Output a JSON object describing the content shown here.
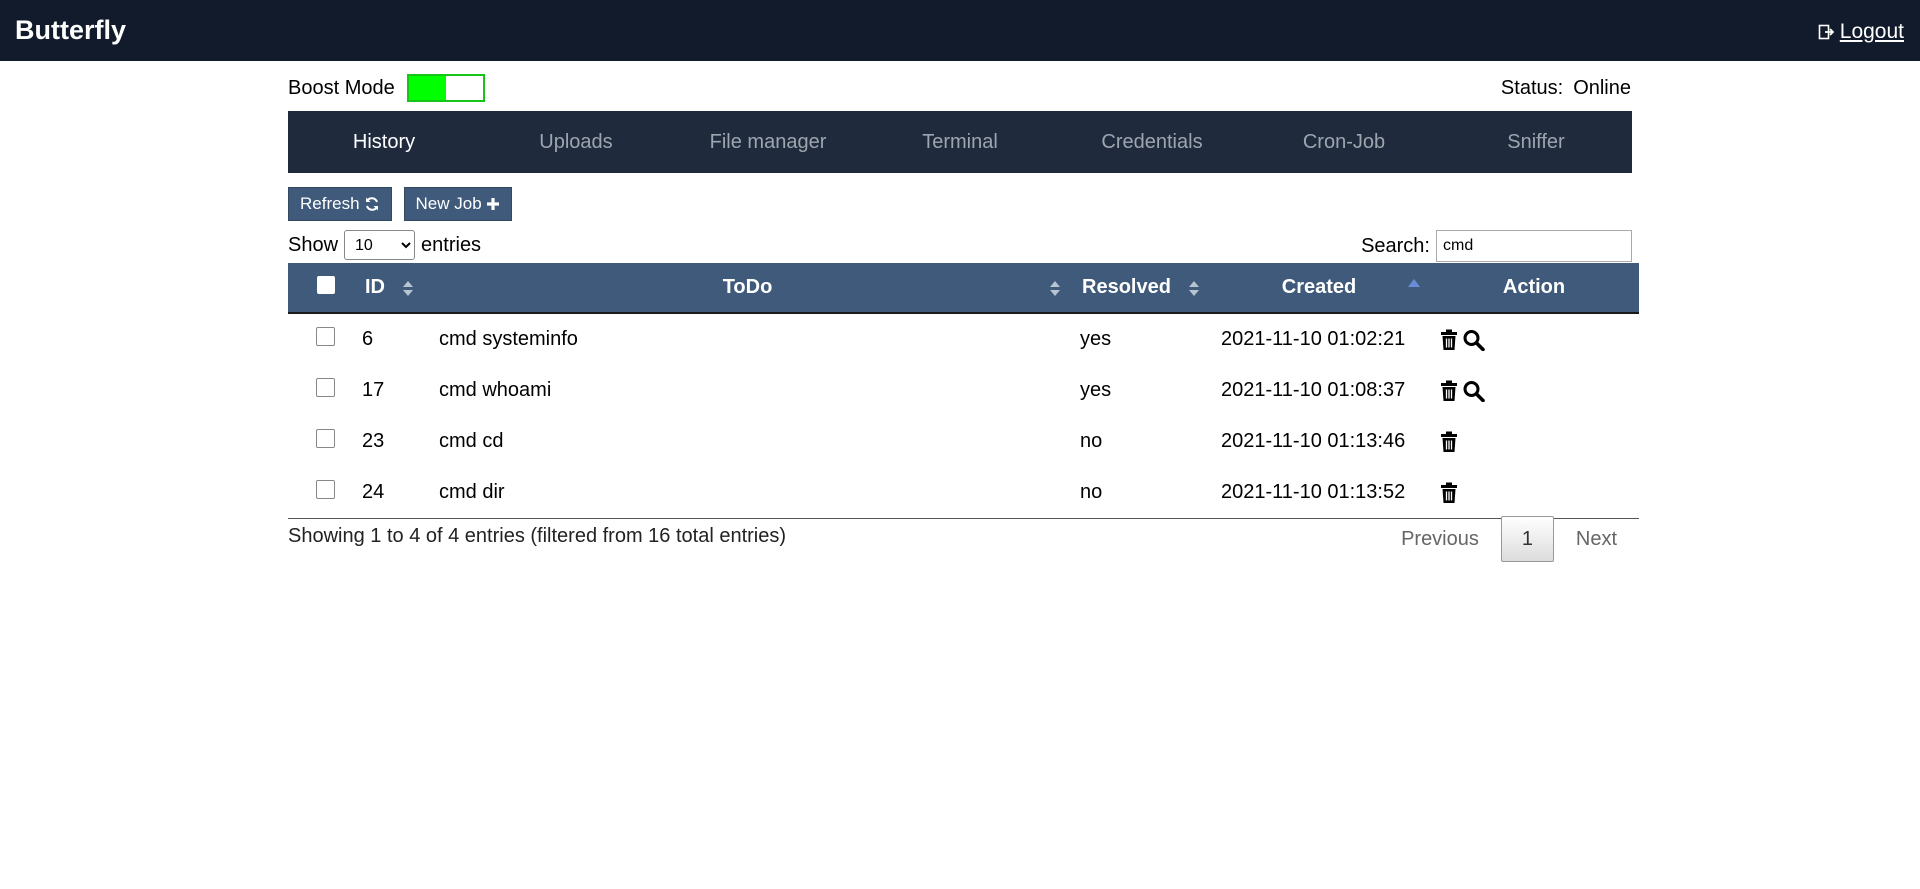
{
  "app": {
    "title": "Butterfly",
    "logout_label": "Logout"
  },
  "boost": {
    "label": "Boost Mode",
    "enabled": true,
    "accent": "#00ff00"
  },
  "status": {
    "label": "Status:",
    "value": "Online"
  },
  "tabs": [
    {
      "label": "History",
      "active": true
    },
    {
      "label": "Uploads"
    },
    {
      "label": "File manager"
    },
    {
      "label": "Terminal"
    },
    {
      "label": "Credentials"
    },
    {
      "label": "Cron-Job"
    },
    {
      "label": "Sniffer"
    }
  ],
  "toolbar": {
    "refresh_label": "Refresh",
    "newjob_label": "New Job"
  },
  "length": {
    "prefix": "Show",
    "value": "10",
    "suffix": "entries"
  },
  "search": {
    "label": "Search:",
    "value": "cmd"
  },
  "table": {
    "headers": {
      "id": "ID",
      "todo": "ToDo",
      "resolved": "Resolved",
      "created": "Created",
      "action": "Action"
    },
    "rows": [
      {
        "id": "6",
        "todo": "cmd systeminfo",
        "resolved": "yes",
        "created": "2021-11-10 01:02:21"
      },
      {
        "id": "17",
        "todo": "cmd whoami",
        "resolved": "yes",
        "created": "2021-11-10 01:08:37"
      },
      {
        "id": "23",
        "todo": "cmd cd",
        "resolved": "no",
        "created": "2021-11-10 01:13:46"
      },
      {
        "id": "24",
        "todo": "cmd dir",
        "resolved": "no",
        "created": "2021-11-10 01:13:52"
      }
    ]
  },
  "footer": {
    "info": "Showing 1 to 4 of 4 entries (filtered from 16 total entries)",
    "prev": "Previous",
    "page": "1",
    "next": "Next"
  },
  "colors": {
    "topbar": "#111b2b",
    "tabs_bg": "#1f2a3d",
    "header_bg": "#3f5a7a"
  }
}
